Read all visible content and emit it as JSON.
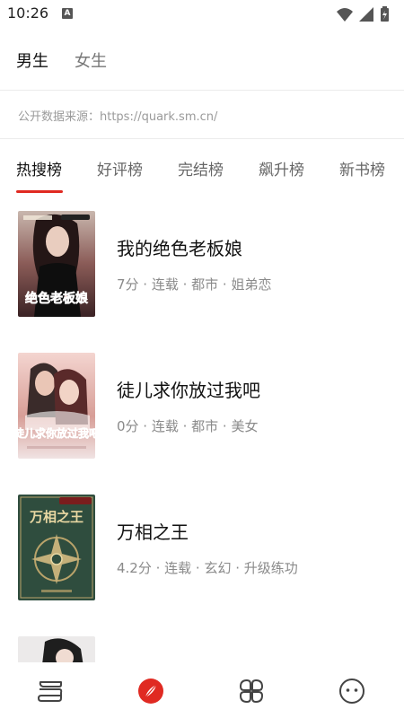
{
  "status_bar": {
    "time": "10:26",
    "notification_badge": "A",
    "icons": [
      "wifi-icon",
      "signal-icon",
      "battery-icon"
    ]
  },
  "gender_tabs": [
    {
      "label": "男生",
      "active": true
    },
    {
      "label": "女生",
      "active": false
    }
  ],
  "source_note": "公开数据来源：https://quark.sm.cn/",
  "rank_tabs": [
    {
      "label": "热搜榜",
      "active": true
    },
    {
      "label": "好评榜",
      "active": false
    },
    {
      "label": "完结榜",
      "active": false
    },
    {
      "label": "飙升榜",
      "active": false
    },
    {
      "label": "新书榜",
      "active": false
    }
  ],
  "books": [
    {
      "title": "我的绝色老板娘",
      "meta": "7分 · 连载 · 都市 · 姐弟恋",
      "cover_text": "绝色老板娘",
      "cover_icon": "book-cover-woman"
    },
    {
      "title": "徒儿求你放过我吧",
      "meta": "0分 · 连载 · 都市 · 美女",
      "cover_text": "徒儿求你放过我吧",
      "cover_icon": "book-cover-couple"
    },
    {
      "title": "万相之王",
      "meta": "4.2分 · 连载 · 玄幻 · 升级练功",
      "cover_text": "万相之王",
      "cover_icon": "book-cover-emblem"
    },
    {
      "title": "",
      "meta": "",
      "cover_text": "",
      "cover_icon": "book-cover-partial"
    }
  ],
  "bottom_nav": [
    {
      "name": "bookshelf-icon",
      "active": false
    },
    {
      "name": "compass-icon",
      "active": true
    },
    {
      "name": "categories-icon",
      "active": false
    },
    {
      "name": "profile-icon",
      "active": false
    }
  ],
  "colors": {
    "accent": "#e02a22",
    "text_primary": "#111111",
    "text_secondary": "#8a8a8a"
  }
}
